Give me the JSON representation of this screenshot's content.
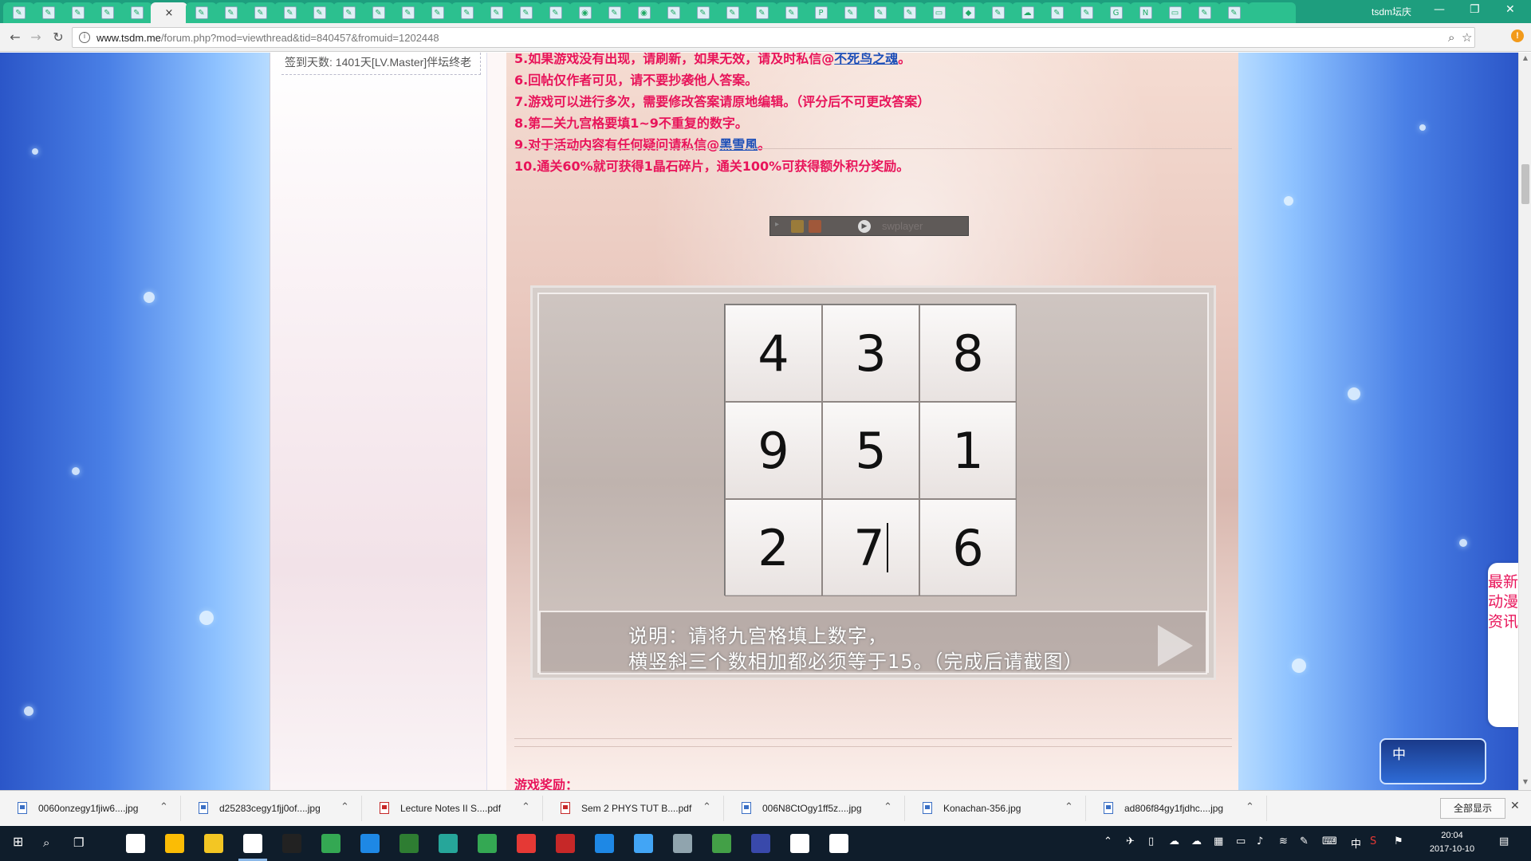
{
  "browser": {
    "profile_name": "tsdm坛庆",
    "url_host": "www.tsdm.me",
    "url_path": "/forum.php?mod=viewthread&tid=840457&fromuid=1202448",
    "close_tab_glyph": "×",
    "window_controls": [
      "—",
      "❐",
      "✕"
    ]
  },
  "sidebar_user": {
    "signin_text": "签到天数: 1401天[LV.Master]伴坛终老"
  },
  "post": {
    "rules": [
      "5.如果游戏没有出现，请刷新，如果无效，请及时私信@",
      "6.回帖仅作者可见，请不要抄袭他人答案。",
      "7.游戏可以进行多次，需要修改答案请原地编辑。（评分后不可更改答案）",
      "8.第二关九宫格要填1~9不重复的数字。",
      "9.对于活动内容有任何疑问请私信@",
      "10.通关60%就可获得1晶石碎片，通关100%可获得额外积分奖励。"
    ],
    "rule5_mention": "不死鸟之魂",
    "rule5_tail": "。",
    "rule9_mention": "黑雪風",
    "rule9_tail": "。",
    "player_label": "swplayer",
    "reward_title": "游戏奖励："
  },
  "puzzle": {
    "grid": [
      [
        "4",
        "3",
        "8"
      ],
      [
        "9",
        "5",
        "1"
      ],
      [
        "2",
        "7",
        "6"
      ]
    ],
    "instruction_line1": "说明：请将九宫格填上数字，",
    "instruction_line2": "横竖斜三个数相加都必须等于15。（完成后请截图）"
  },
  "side_widget": {
    "news_label": "最新动漫资讯",
    "ime_label": "中"
  },
  "downloads": {
    "items": [
      {
        "name": "0060onzegy1fjiw6....jpg",
        "type": "jpg"
      },
      {
        "name": "d25283cegy1fjj0of....jpg",
        "type": "jpg"
      },
      {
        "name": "Lecture Notes II S....pdf",
        "type": "pdf"
      },
      {
        "name": "Sem 2 PHYS TUT B....pdf",
        "type": "pdf"
      },
      {
        "name": "006N8CtOgy1ff5z....jpg",
        "type": "jpg"
      },
      {
        "name": "Konachan-356.jpg",
        "type": "jpg"
      },
      {
        "name": "ad806f84gy1fjdhc....jpg",
        "type": "jpg"
      }
    ],
    "show_all_label": "全部显示",
    "close_glyph": "✕"
  },
  "taskbar": {
    "time": "20:04",
    "date": "2017-10-10",
    "ime_indicator": "中",
    "app_colors": [
      "#ffffff",
      "#fbbc05",
      "#f3c623",
      "#ffffff",
      "#222222",
      "#34a853",
      "#1e88e5",
      "#2e7d32",
      "#26a69a",
      "#34a853",
      "#e53935",
      "#c62828",
      "#1e88e5",
      "#42a5f5",
      "#90a4ae",
      "#43a047",
      "#3949ab",
      "#ffffff",
      "#ffffff"
    ]
  },
  "colors": {
    "rule_text": "#e8145a",
    "mention": "#1d4fb8",
    "tab_strip": "#1e9e7e"
  }
}
